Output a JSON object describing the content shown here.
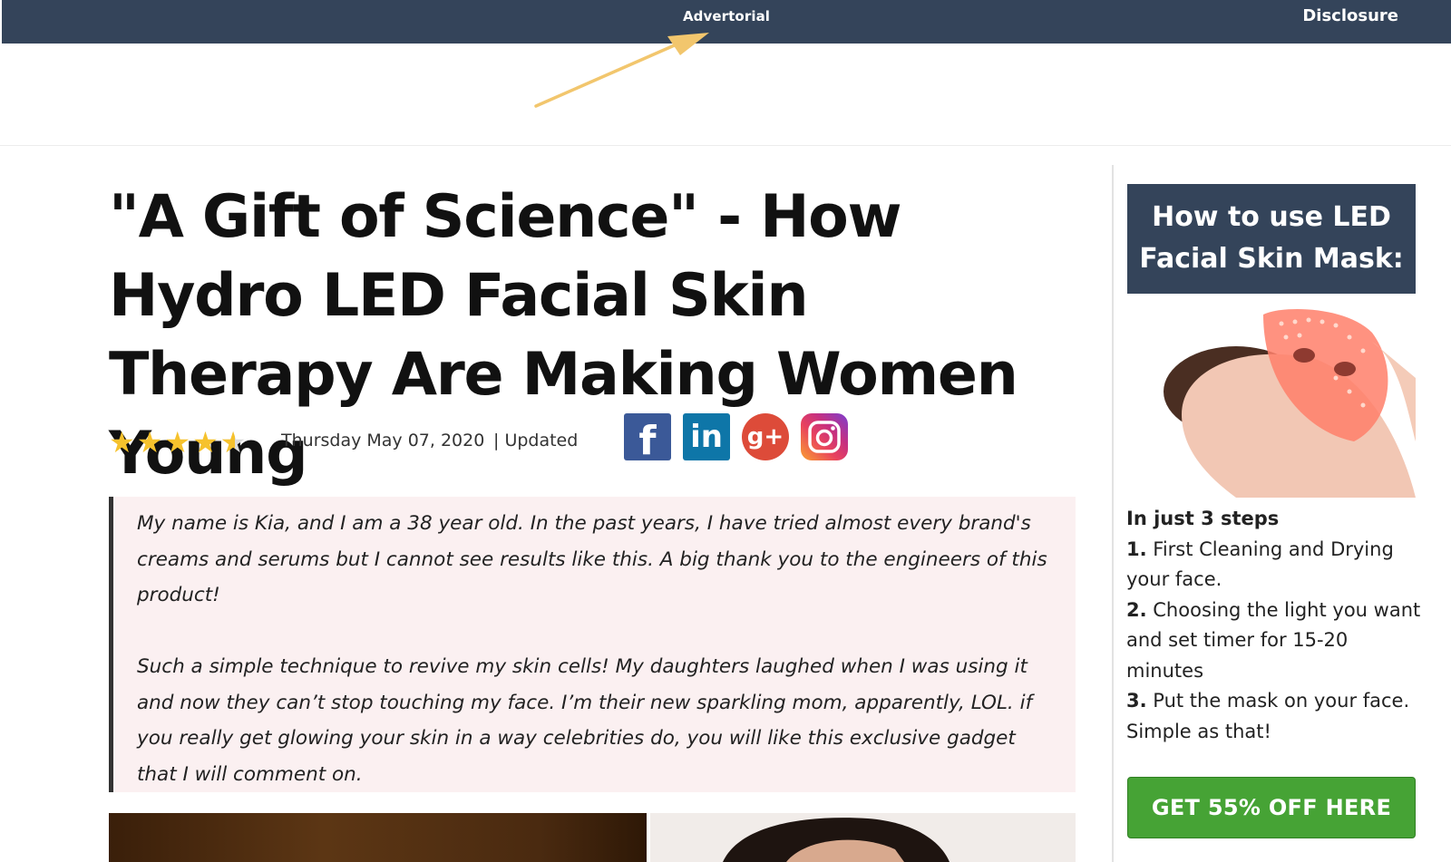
{
  "topbar": {
    "label": "Advertorial",
    "right_link": "Disclosure"
  },
  "article": {
    "headline": "\"A Gift of Science\" - How Hydro LED Facial Skin Therapy Are Making Women Young",
    "rating": 4.5,
    "date": "Thursday May 07, 2020",
    "updated": "| Updated",
    "social_icons": [
      "facebook-icon",
      "linkedin-icon",
      "google-plus-icon",
      "instagram-icon"
    ],
    "quote_paragraphs": [
      "My name is Kia, and I am a 38 year old. In the past years, I have tried almost every brand's creams and serums but I cannot see results like this. A big thank you to the engineers of this product!",
      "Such a simple technique to revive my skin cells! My daughters laughed when I was using it and now they can’t stop touching my face. I’m their new sparkling mom, apparently, LOL. if you really get glowing your skin in a way celebrities do, you will like this exclusive gadget that I will comment on."
    ]
  },
  "sidebar": {
    "heading": "How to use LED Facial Skin Mask:",
    "intro": "In just 3 steps",
    "steps": [
      {
        "num": "1.",
        "text": " First Cleaning and Drying your face."
      },
      {
        "num": "2.",
        "text": " Choosing the light you want and set timer for 15-20 minutes"
      },
      {
        "num": "3.",
        "text": " Put the mask on your face. Simple as that!"
      }
    ],
    "cta_label": "GET 55% OFF HERE"
  },
  "colors": {
    "topbar_bg": "#34445a",
    "quote_bg": "#fbf0f1",
    "cta_bg": "#46a335",
    "star": "#f6c22d",
    "arrow": "#f2c66d"
  }
}
